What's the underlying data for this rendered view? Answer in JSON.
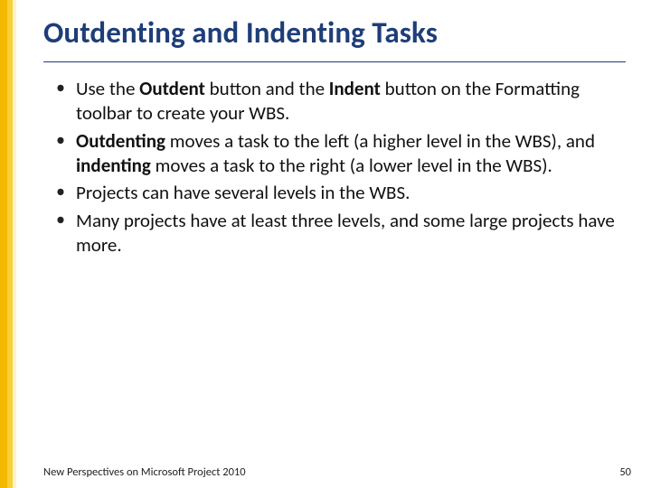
{
  "title": "Outdenting and Indenting Tasks",
  "bullets": {
    "b1": {
      "p1": "Use the ",
      "s1": "Outdent",
      "p2": " button and the ",
      "s2": "Indent",
      "p3": " button on the Formatting toolbar to create your WBS."
    },
    "b2": {
      "s1": "Outdenting",
      "p1": " moves a task to the left (a higher level in the WBS), and ",
      "s2": "indenting",
      "p2": " moves a task to the right (a lower level in the WBS)."
    },
    "b3": "Projects can have several levels in the WBS.",
    "b4": "Many projects have at least three levels, and some large projects have more."
  },
  "footer": {
    "source": "New Perspectives on Microsoft Project 2010",
    "page": "50"
  }
}
